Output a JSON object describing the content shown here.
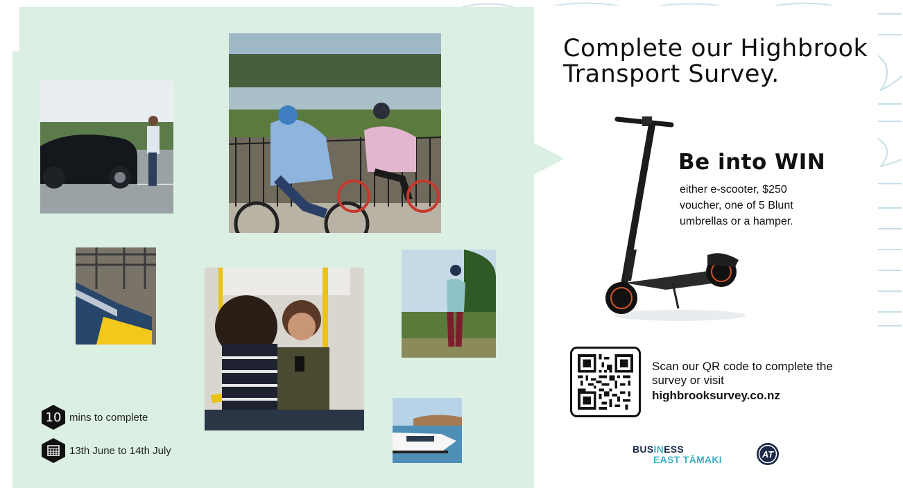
{
  "headline": "Complete our Highbrook Transport Survey.",
  "prize": {
    "title": "Be into WIN",
    "description": "either e-scooter, $250 voucher, one of 5 Blunt umbrellas or a hamper."
  },
  "qr": {
    "text": "Scan our QR code to complete the survey or visit",
    "url": "highbrooksurvey.co.nz"
  },
  "info": {
    "duration_number": "10",
    "duration_text": "mins to complete",
    "dates_text": "13th June to 14th July"
  },
  "logos": {
    "bet_line1_a": "BUS",
    "bet_line1_b": "IN",
    "bet_line1_c": "ESS",
    "bet_line2": "EAST TĀMAKI",
    "at": "AT"
  },
  "colors": {
    "panel_green": "#dcefe3",
    "accent_teal": "#3ab0c3",
    "navy": "#1b2a47",
    "text": "#111111"
  }
}
